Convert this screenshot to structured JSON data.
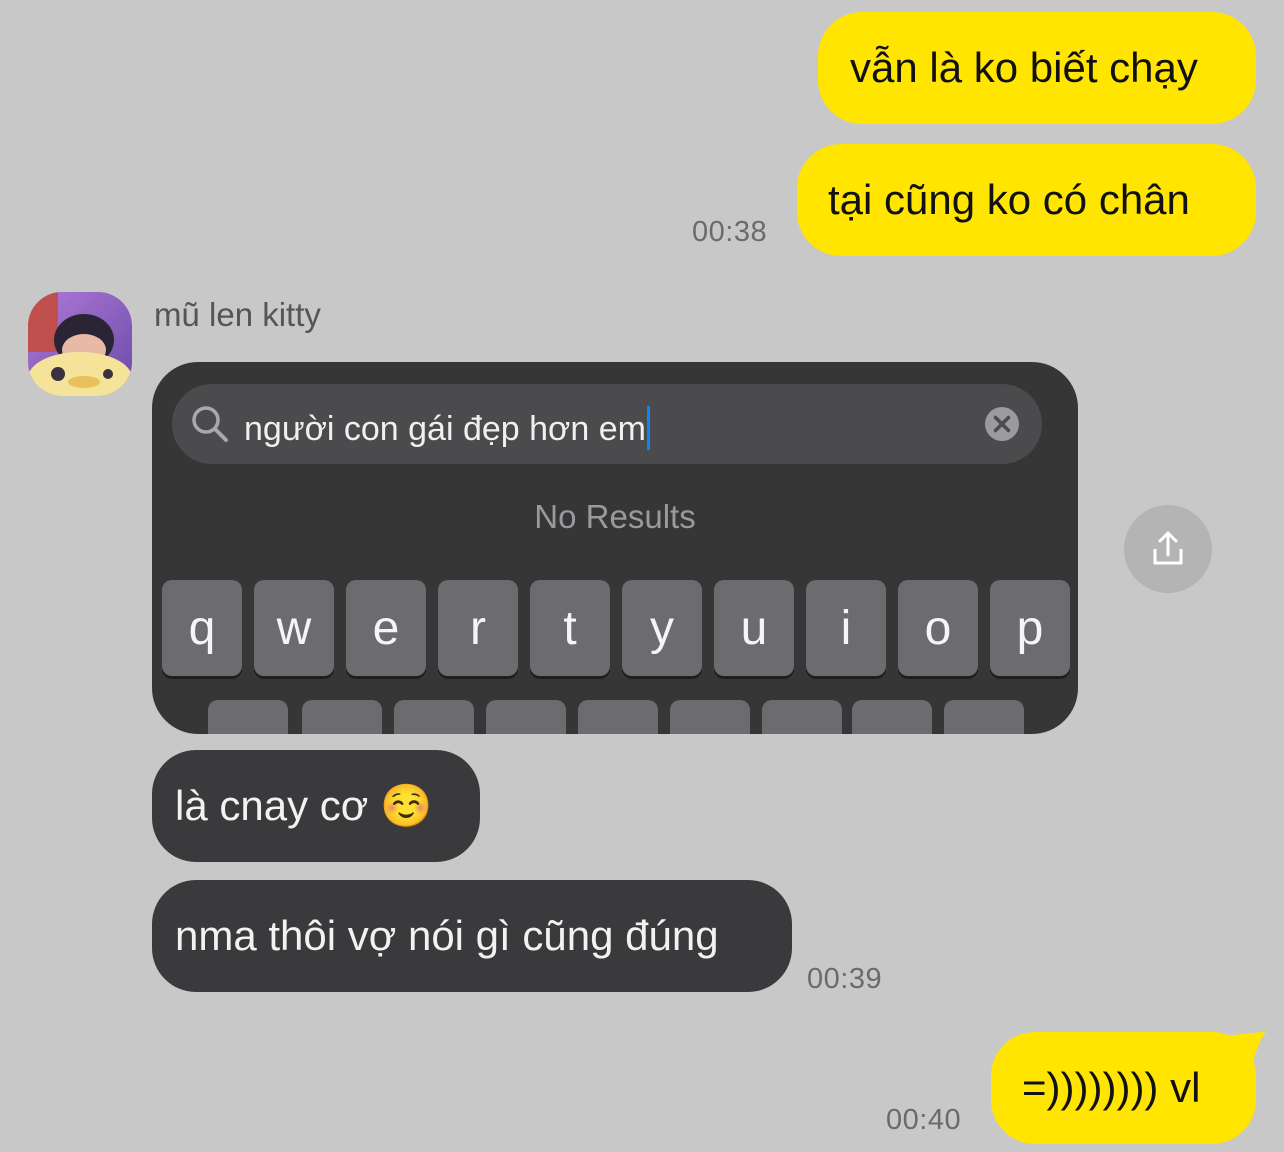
{
  "messages": {
    "out1": "vẫn là ko biết chạy",
    "out2": "tại cũng ko có chân",
    "time1": "00:38",
    "sender": "mũ len kitty",
    "in1": "là cnay cơ ☺️",
    "in2": "nma thôi vợ nói gì cũng đúng",
    "time2": "00:39",
    "out3": "=)))))))) vl",
    "time3": "00:40"
  },
  "screenshot": {
    "search_text": "người con gái đẹp hơn em",
    "no_results": "No Results",
    "keys": [
      "q",
      "w",
      "e",
      "r",
      "t",
      "y",
      "u",
      "i",
      "o",
      "p"
    ]
  },
  "icons": {
    "search": "magnifier-icon",
    "clear": "clear-circle-icon",
    "share": "share-icon"
  },
  "colors": {
    "background": "#c8c8c8",
    "outgoing_bubble": "#ffe500",
    "incoming_bubble": "#3a3a3c",
    "caret": "#0a84ff"
  }
}
